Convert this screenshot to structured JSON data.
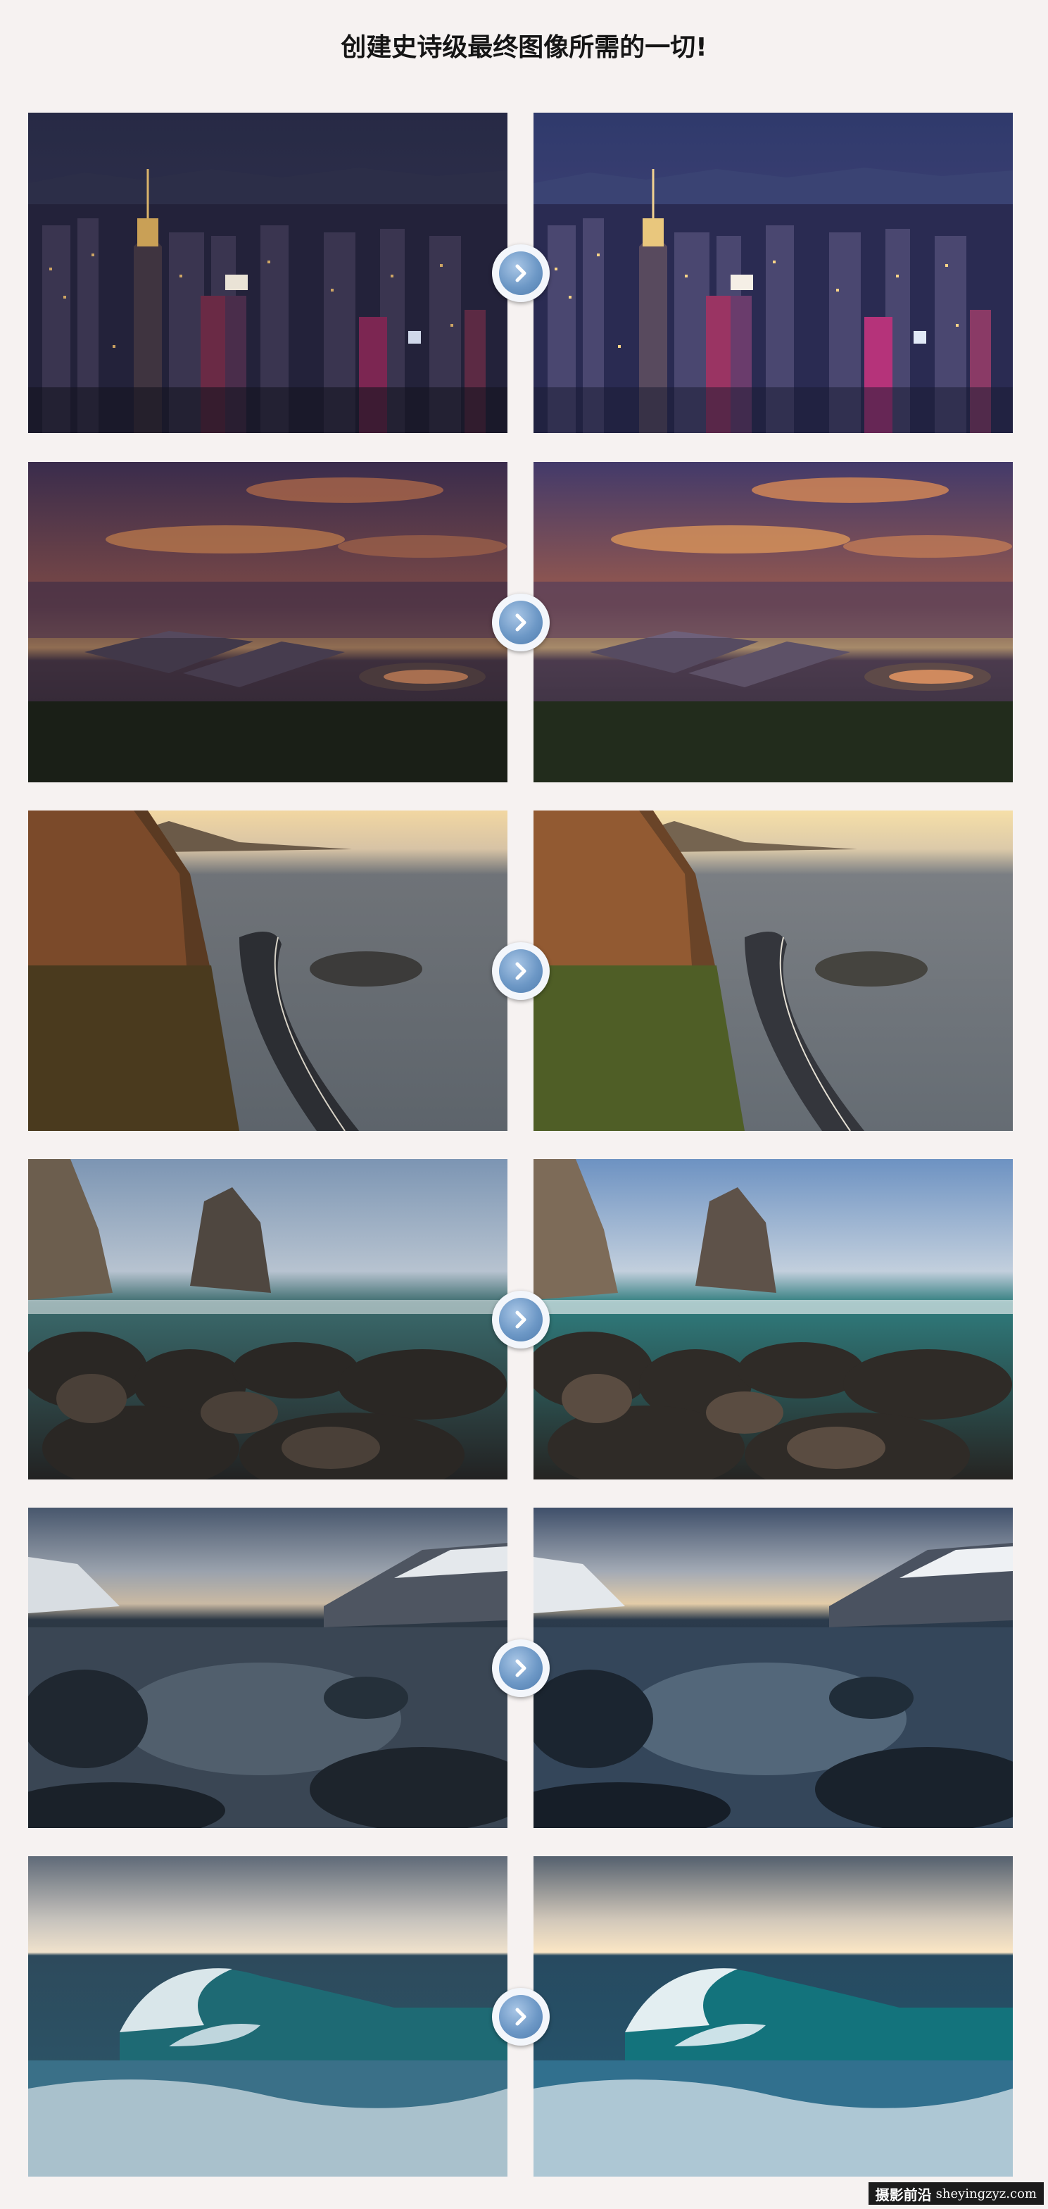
{
  "page": {
    "title": "创建史诗级最终图像所需的一切!"
  },
  "pairs": [
    {
      "scene": "city-night",
      "before_label": "",
      "after_label": ""
    },
    {
      "scene": "sunset-tidepools",
      "before_label": "",
      "after_label": ""
    },
    {
      "scene": "coastal-road",
      "before_label": "",
      "after_label": ""
    },
    {
      "scene": "rocky-beach",
      "before_label": "",
      "after_label": ""
    },
    {
      "scene": "mountain-river",
      "before_label": "",
      "after_label": ""
    },
    {
      "scene": "ocean-wave",
      "before_label": "",
      "after_label": ""
    }
  ],
  "icons": {
    "compare_arrow": "chevron-right-circle-icon"
  },
  "watermark": {
    "site_name": "摄影前沿",
    "url": "sheyingzyz.com"
  },
  "colors": {
    "background": "#f6f2f1",
    "arrow_blue": "#6d98c6",
    "title": "#151515"
  }
}
